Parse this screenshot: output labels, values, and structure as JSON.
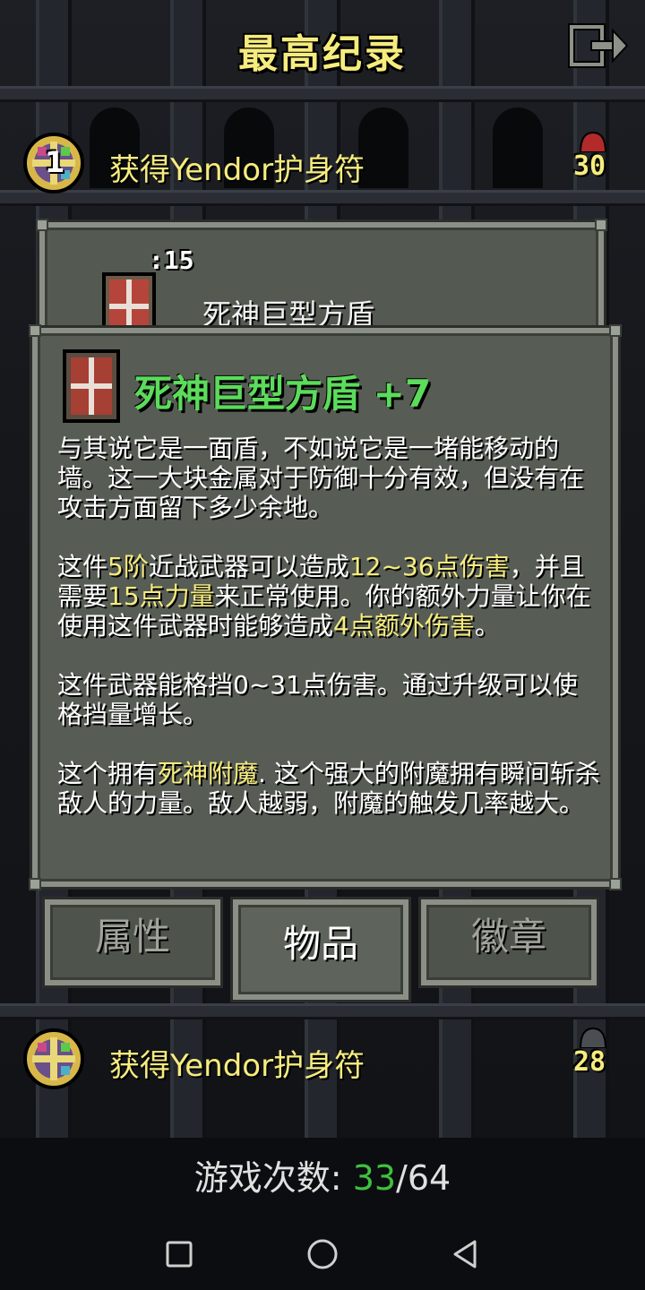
{
  "header": {
    "title": "最高纪录",
    "exit_icon": "exit-icon"
  },
  "records": [
    {
      "rank": "1",
      "text": "获得Yendor护身符",
      "score": "30",
      "icon": "amulet-icon"
    },
    {
      "rank": "",
      "text": "获得Yendor护身符",
      "score": "28",
      "icon": "amulet-icon"
    }
  ],
  "item_card": {
    "quantity": ":15",
    "name": "死神巨型方盾",
    "icon": "greatshield-icon"
  },
  "item_info": {
    "title": "死神巨型方盾 +7",
    "icon": "greatshield-icon",
    "p1": "与其说它是一面盾，不如说它是一堵能移动的墙。这一大块金属对于防御十分有效，但没有在攻击方面留下多少余地。",
    "p2": {
      "a": "这件",
      "tier": "5阶",
      "b": "近战武器可以造成",
      "damage": "12~36点伤害",
      "c": "，并且需要",
      "str": "15点力量",
      "d": "来正常使用。你的额外力量让你在使用这件武器时能够造成",
      "bonus": "4点额外伤害",
      "e": "。"
    },
    "p3": "这件武器能格挡0~31点伤害。通过升级可以使格挡量增长。",
    "p4": {
      "a": "这个拥有",
      "enchant": "死神附魔",
      "b": ". 这个强大的附魔拥有瞬间斩杀敌人的力量。敌人越弱，附魔的触发几率越大。"
    }
  },
  "tabs": [
    {
      "label": "属性",
      "active": false
    },
    {
      "label": "物品",
      "active": true
    },
    {
      "label": "徽章",
      "active": false
    }
  ],
  "footer": {
    "games_label": "游戏次数:",
    "games_current": "33",
    "games_separator": "/",
    "games_total": "64"
  },
  "navbar": {
    "buttons": [
      "recent-apps-icon",
      "home-icon",
      "back-icon"
    ]
  },
  "colors": {
    "title_yellow": "#f6ec7e",
    "item_green": "#5bdc5b",
    "games_green": "#3fc13f",
    "panel": "#545a52"
  }
}
